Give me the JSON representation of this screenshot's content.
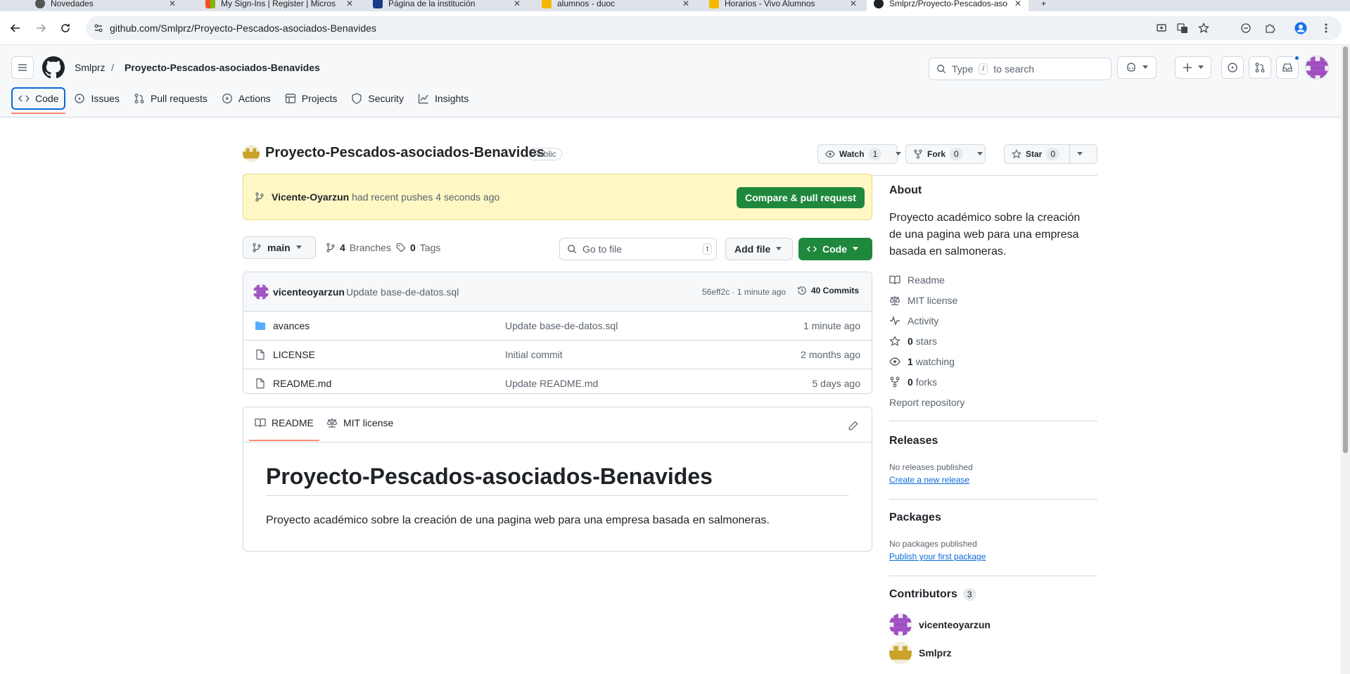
{
  "browser": {
    "tabs": [
      {
        "label": "Novedades"
      },
      {
        "label": "My Sign-Ins | Register | Micros"
      },
      {
        "label": "Página de la institución"
      },
      {
        "label": "alumnos - duoc"
      },
      {
        "label": "Horarios - Vivo Alumnos"
      },
      {
        "label": "Smlprz/Proyecto-Pescados-aso"
      }
    ],
    "url": "github.com/Smlprz/Proyecto-Pescados-asociados-Benavides"
  },
  "header": {
    "owner": "Smlprz",
    "separator": "/",
    "repo": "Proyecto-Pescados-asociados-Benavides",
    "search_prefix": "Type",
    "search_key": "/",
    "search_suffix": "to search"
  },
  "repo_nav": {
    "tabs": [
      {
        "label": "Code"
      },
      {
        "label": "Issues"
      },
      {
        "label": "Pull requests"
      },
      {
        "label": "Actions"
      },
      {
        "label": "Projects"
      },
      {
        "label": "Security"
      },
      {
        "label": "Insights"
      }
    ]
  },
  "repo": {
    "name": "Proyecto-Pescados-asociados-Benavides",
    "visibility": "Public",
    "watch_label": "Watch",
    "watch_count": "1",
    "fork_label": "Fork",
    "fork_count": "0",
    "star_label": "Star",
    "star_count": "0"
  },
  "push_banner": {
    "user": "Vicente-Oyarzun",
    "text": "had recent pushes 4 seconds ago",
    "button": "Compare & pull request"
  },
  "filebar": {
    "branch": "main",
    "branches_count": "4",
    "branches_label": "Branches",
    "tags_count": "0",
    "tags_label": "Tags",
    "goto_placeholder": "Go to file",
    "goto_key": "t",
    "add_file": "Add file",
    "code": "Code"
  },
  "commit": {
    "author": "vicenteoyarzun",
    "message": "Update base-de-datos.sql",
    "meta": "56eff2c · 1 minute ago",
    "commits": "40 Commits"
  },
  "files": [
    {
      "name": "avances",
      "type": "folder",
      "message": "Update base-de-datos.sql",
      "date": "1 minute ago"
    },
    {
      "name": "LICENSE",
      "type": "file",
      "message": "Initial commit",
      "date": "2 months ago"
    },
    {
      "name": "README.md",
      "type": "file",
      "message": "Update README.md",
      "date": "5 days ago"
    }
  ],
  "readme": {
    "tab_readme": "README",
    "tab_license": "MIT license",
    "title": "Proyecto-Pescados-asociados-Benavides",
    "body": "Proyecto académico sobre la creación de una pagina web para una empresa basada en salmoneras."
  },
  "about": {
    "heading": "About",
    "description": "Proyecto académico sobre la creación de una pagina web para una empresa basada en salmoneras.",
    "readme": "Readme",
    "license": "MIT license",
    "activity": "Activity",
    "stars_count": "0",
    "stars_label": "stars",
    "watching_count": "1",
    "watching_label": "watching",
    "forks_count": "0",
    "forks_label": "forks",
    "report": "Report repository"
  },
  "releases": {
    "heading": "Releases",
    "none": "No releases published",
    "link": "Create a new release"
  },
  "packages": {
    "heading": "Packages",
    "none": "No packages published",
    "link": "Publish your first package"
  },
  "contributors": {
    "heading": "Contributors",
    "count": "3",
    "list": [
      {
        "name": "vicenteoyarzun"
      },
      {
        "name": "Smlprz"
      }
    ]
  },
  "colors": {
    "accent": "#0969da",
    "green": "#1f883d",
    "banner": "#fff8c5",
    "tab_underline": "#fd8c73"
  }
}
